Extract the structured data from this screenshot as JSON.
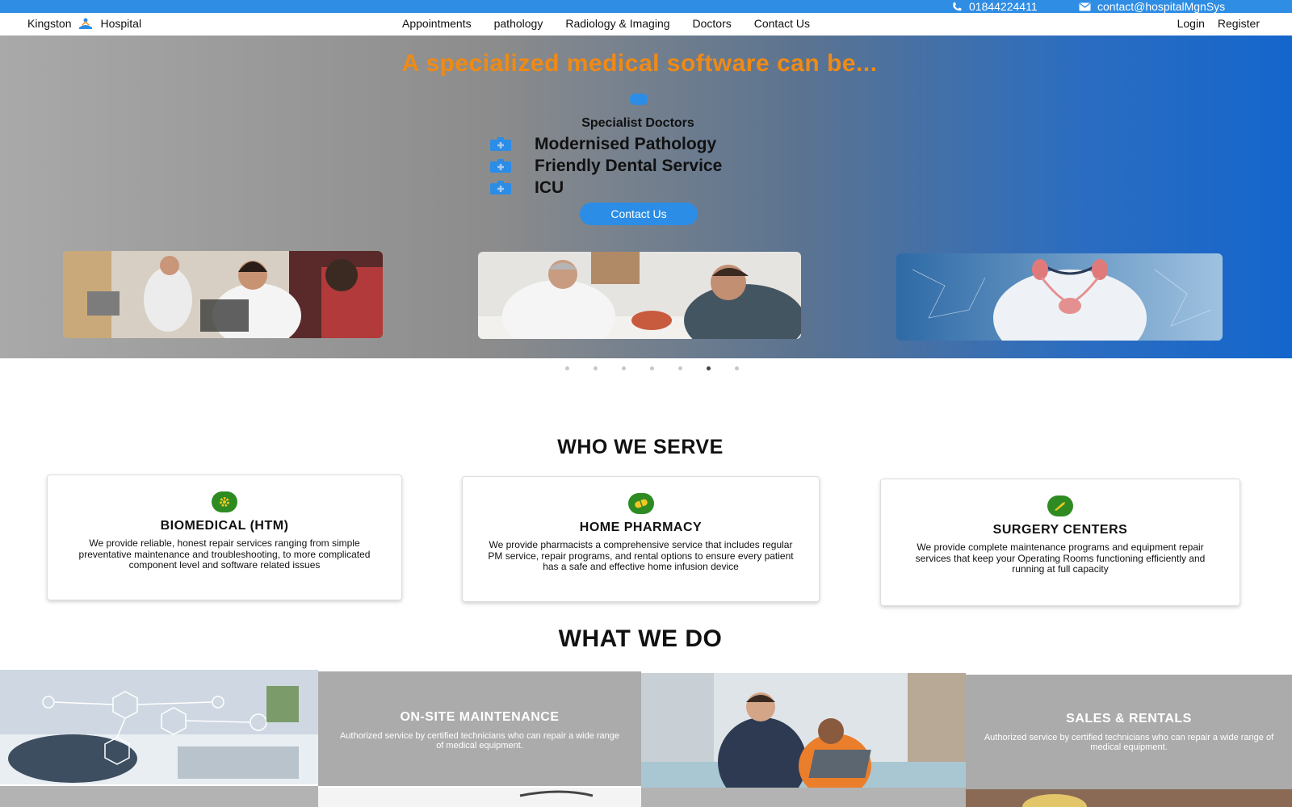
{
  "topbar": {
    "phone": "01844224411",
    "email": "contact@hospitalMgnSys"
  },
  "nav": {
    "brand_left": "Kingston",
    "brand_right": "Hospital",
    "links": [
      "Appointments",
      "pathology",
      "Radiology & Imaging",
      "Doctors",
      "Contact Us"
    ],
    "login": "Login",
    "register": "Register"
  },
  "hero": {
    "title": "A specialized medical software can be...",
    "subtitle": "Specialist Doctors",
    "features": [
      "Modernised Pathology",
      "Friendly Dental Service",
      "ICU"
    ],
    "cta": "Contact Us",
    "carousel_active_index": 5,
    "carousel_count": 7
  },
  "who_we_serve": {
    "heading": "WHO WE SERVE",
    "cards": [
      {
        "icon": "gear-icon",
        "title": "BIOMEDICAL (HTM)",
        "text": "We provide reliable, honest repair services ranging from simple preventative maintenance and troubleshooting, to more complicated component level and software related issues"
      },
      {
        "icon": "pill-icon",
        "title": "HOME PHARMACY",
        "text": "We provide pharmacists a comprehensive service that includes regular PM service, repair programs, and rental options to ensure every patient has a safe and effective home infusion device"
      },
      {
        "icon": "scalpel-icon",
        "title": "SURGERY CENTERS",
        "text": "We provide complete maintenance programs and equipment repair services that keep your Operating Rooms functioning efficiently and running at full capacity"
      }
    ]
  },
  "what_we_do": {
    "heading": "WHAT WE DO",
    "tiles": [
      {
        "title": "ON-SITE MAINTENANCE",
        "text": "Authorized service by certified technicians who can repair a wide range of medical equipment."
      },
      {
        "title": "SALES & RENTALS",
        "text": "Authorized service by certified technicians who can repair a wide range of medical equipment."
      }
    ]
  },
  "colors": {
    "topbar": "#2f8de4",
    "accent_orange": "#f08a14",
    "button_blue": "#2b8de6",
    "card_icon_green": "#2e8b22",
    "tile_gray": "#ababab"
  }
}
